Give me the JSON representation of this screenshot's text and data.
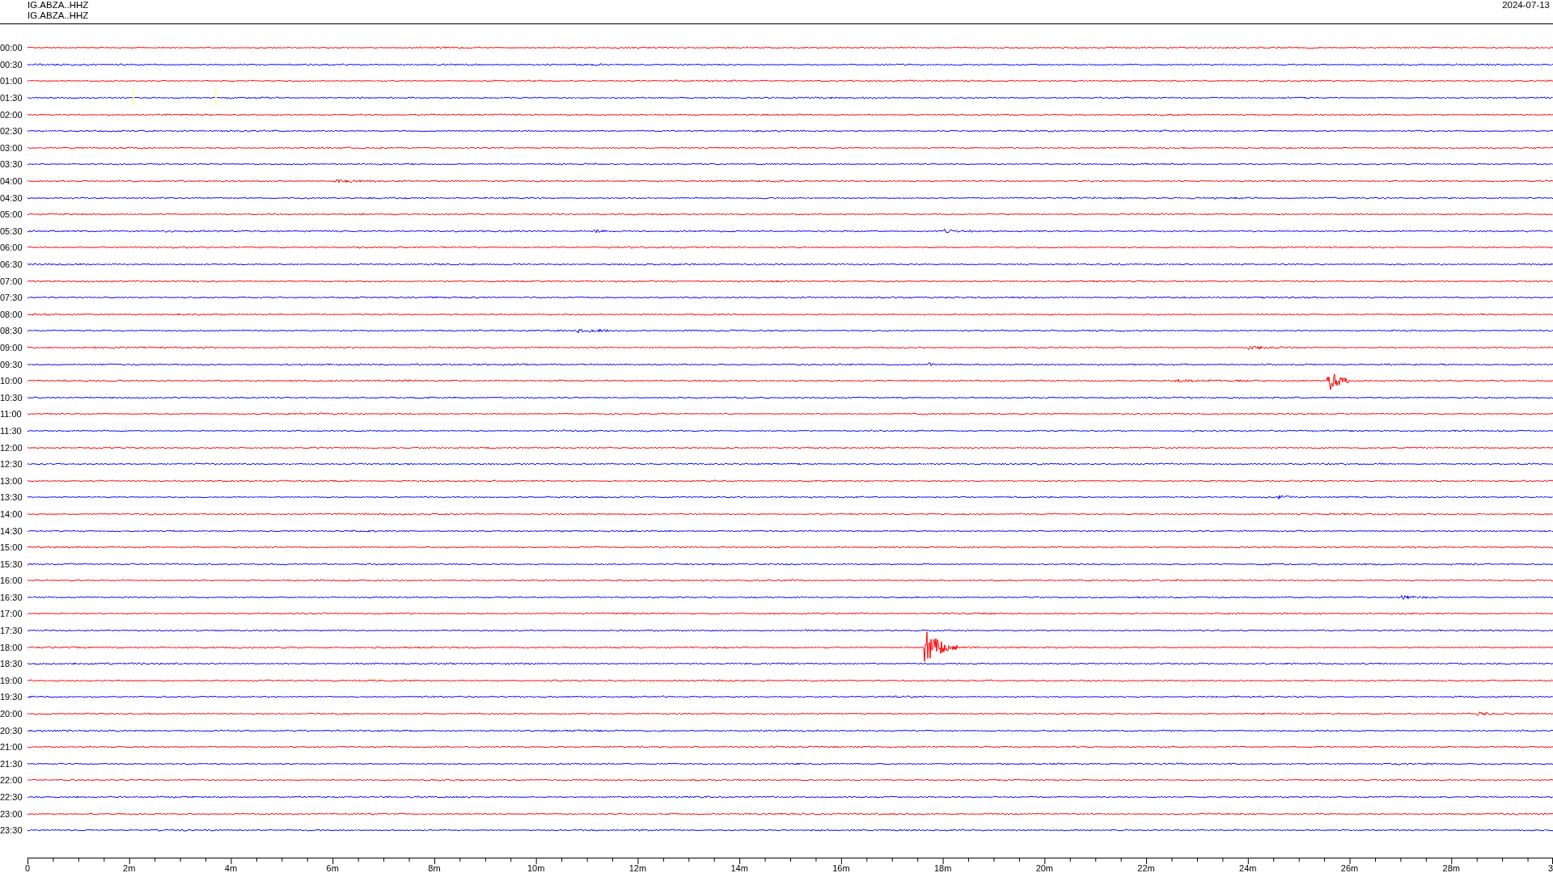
{
  "header": {
    "station_lines": [
      "IG.ABZA..HHZ",
      "IG.ABZA..HHZ"
    ],
    "date": "2024-07-13"
  },
  "rows": [
    {
      "time": "00:00",
      "color": "#ff0000"
    },
    {
      "time": "00:30",
      "color": "#0000ff"
    },
    {
      "time": "01:00",
      "color": "#ff0000"
    },
    {
      "time": "01:30",
      "color": "#0000ff"
    },
    {
      "time": "02:00",
      "color": "#ff0000"
    },
    {
      "time": "02:30",
      "color": "#0000ff"
    },
    {
      "time": "03:00",
      "color": "#ff0000"
    },
    {
      "time": "03:30",
      "color": "#0000ff"
    },
    {
      "time": "04:00",
      "color": "#ff0000"
    },
    {
      "time": "04:30",
      "color": "#0000ff"
    },
    {
      "time": "05:00",
      "color": "#ff0000"
    },
    {
      "time": "05:30",
      "color": "#0000ff"
    },
    {
      "time": "06:00",
      "color": "#ff0000"
    },
    {
      "time": "06:30",
      "color": "#0000ff"
    },
    {
      "time": "07:00",
      "color": "#ff0000"
    },
    {
      "time": "07:30",
      "color": "#0000ff"
    },
    {
      "time": "08:00",
      "color": "#ff0000"
    },
    {
      "time": "08:30",
      "color": "#0000ff"
    },
    {
      "time": "09:00",
      "color": "#ff0000"
    },
    {
      "time": "09:30",
      "color": "#0000ff"
    },
    {
      "time": "10:00",
      "color": "#ff0000"
    },
    {
      "time": "10:30",
      "color": "#0000ff"
    },
    {
      "time": "11:00",
      "color": "#ff0000"
    },
    {
      "time": "11:30",
      "color": "#0000ff"
    },
    {
      "time": "12:00",
      "color": "#ff0000"
    },
    {
      "time": "12:30",
      "color": "#0000ff"
    },
    {
      "time": "13:00",
      "color": "#ff0000"
    },
    {
      "time": "13:30",
      "color": "#0000ff"
    },
    {
      "time": "14:00",
      "color": "#ff0000"
    },
    {
      "time": "14:30",
      "color": "#0000ff"
    },
    {
      "time": "15:00",
      "color": "#ff0000"
    },
    {
      "time": "15:30",
      "color": "#0000ff"
    },
    {
      "time": "16:00",
      "color": "#ff0000"
    },
    {
      "time": "16:30",
      "color": "#0000ff"
    },
    {
      "time": "17:00",
      "color": "#ff0000"
    },
    {
      "time": "17:30",
      "color": "#0000ff"
    },
    {
      "time": "18:00",
      "color": "#ff0000"
    },
    {
      "time": "18:30",
      "color": "#0000ff"
    },
    {
      "time": "19:00",
      "color": "#ff0000"
    },
    {
      "time": "19:30",
      "color": "#0000ff"
    },
    {
      "time": "20:00",
      "color": "#ff0000"
    },
    {
      "time": "20:30",
      "color": "#0000ff"
    },
    {
      "time": "21:00",
      "color": "#ff0000"
    },
    {
      "time": "21:30",
      "color": "#0000ff"
    },
    {
      "time": "22:00",
      "color": "#ff0000"
    },
    {
      "time": "22:30",
      "color": "#0000ff"
    },
    {
      "time": "23:00",
      "color": "#ff0000"
    },
    {
      "time": "23:30",
      "color": "#0000ff"
    }
  ],
  "x_axis": {
    "labels": [
      "0",
      "2m",
      "4m",
      "6m",
      "8m",
      "10m",
      "12m",
      "14m",
      "16m",
      "18m",
      "20m",
      "22m",
      "24m",
      "26m",
      "28m",
      "3"
    ]
  }
}
